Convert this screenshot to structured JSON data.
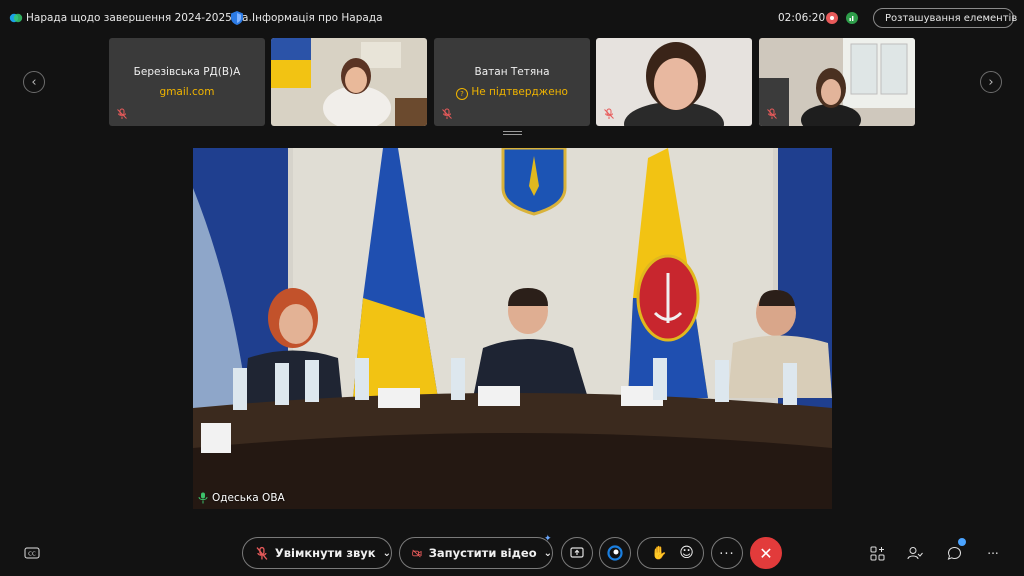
{
  "window": {
    "meeting_title": "Нарада щодо завершення 2024-2025 на...",
    "info_label": "Інформація про Нарада",
    "timer": "02:06:20",
    "layout_button": "Розташування елементів"
  },
  "participants": [
    {
      "name": "Березівська РД(В)А",
      "subtitle": "gmail.com",
      "subtitle_color": "#f0b400",
      "type": "avatar-text"
    },
    {
      "name": "",
      "type": "video"
    },
    {
      "name": "Ватан Тетяна",
      "subtitle": "Не підтверджено",
      "subtitle_color": "#f0b400",
      "type": "avatar-text"
    },
    {
      "name": "",
      "type": "video"
    },
    {
      "name": "",
      "type": "video"
    }
  ],
  "main_stage": {
    "speaker": "Одеська ОВА"
  },
  "controls": {
    "unmute_label": "Увімкнути звук",
    "start_video_label": "Запустити відео",
    "leave_color": "#e23b3b",
    "accent": "#1a7fe0"
  }
}
